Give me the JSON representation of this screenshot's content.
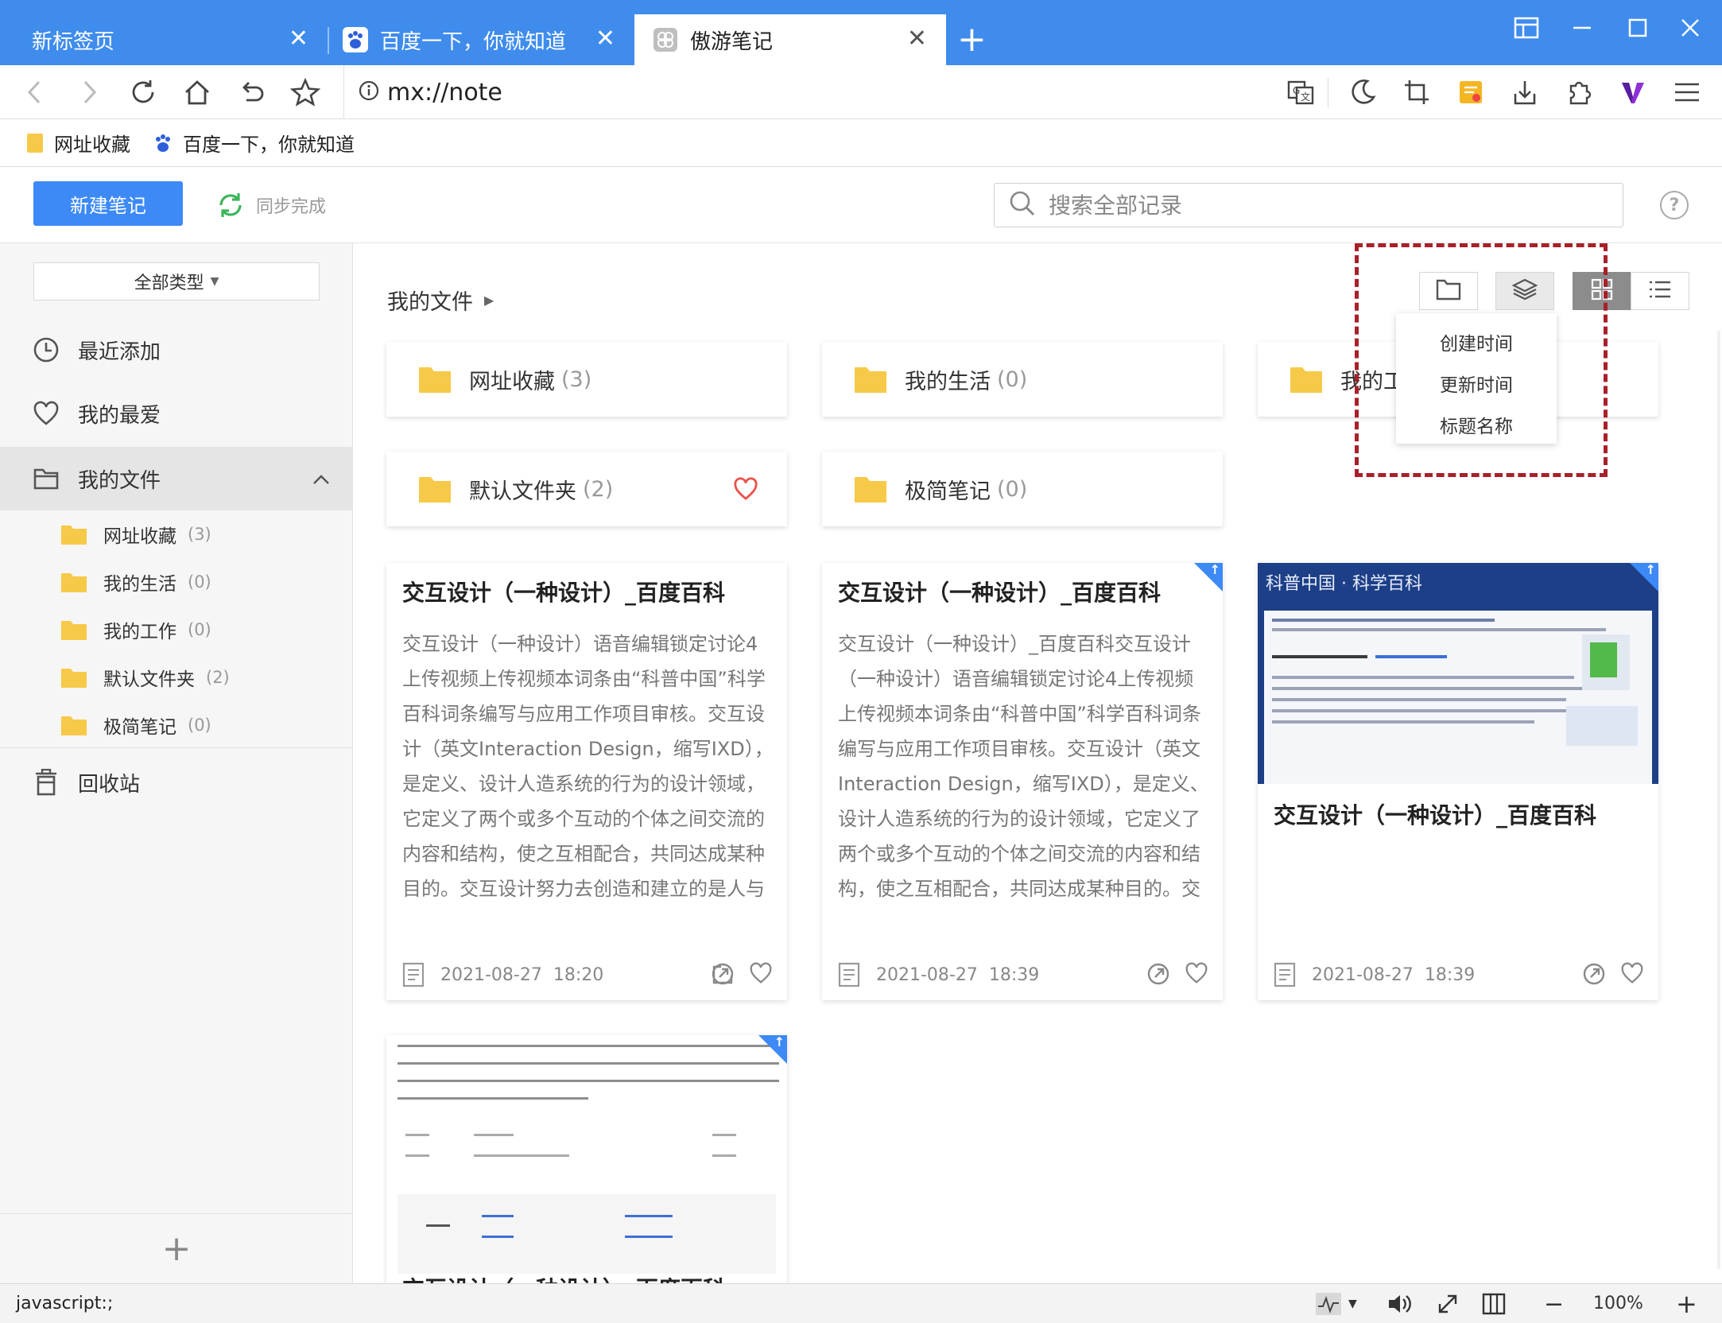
{
  "browser": {
    "tabs": [
      {
        "title": "新标签页",
        "active": false
      },
      {
        "title": "百度一下，你就知道",
        "active": false
      },
      {
        "title": "傲游笔记",
        "active": true
      }
    ],
    "address": "mx://note",
    "bookmarks": [
      {
        "label": "网址收藏",
        "icon": "folder-icon"
      },
      {
        "label": "百度一下，你就知道",
        "icon": "baidu-paw-icon"
      }
    ],
    "status_text": "javascript:;",
    "zoom": "100%"
  },
  "header": {
    "new_note_label": "新建笔记",
    "sync_label": "同步完成",
    "search_placeholder": "搜索全部记录",
    "help_label": "?"
  },
  "sidebar": {
    "type_filter": "全部类型",
    "items": {
      "recent": "最近添加",
      "favorites": "我的最爱",
      "my_files": "我的文件",
      "trash": "回收站"
    },
    "folders": [
      {
        "name": "网址收藏",
        "count": "(3)"
      },
      {
        "name": "我的生活",
        "count": "(0)"
      },
      {
        "name": "我的工作",
        "count": "(0)"
      },
      {
        "name": "默认文件夹",
        "count": "(2)"
      },
      {
        "name": "极简笔记",
        "count": "(0)"
      }
    ],
    "add_label": "+"
  },
  "main": {
    "breadcrumb": "我的文件",
    "folder_cards": [
      {
        "name": "网址收藏",
        "count": "(3)"
      },
      {
        "name": "我的生活",
        "count": "(0)"
      },
      {
        "name": "我的工",
        "count": ""
      },
      {
        "name": "默认文件夹",
        "count": "(2)"
      },
      {
        "name": "极简笔记",
        "count": "(0)"
      }
    ],
    "notes": [
      {
        "title": "交互设计（一种设计）_百度百科",
        "body": "交互设计（一种设计）语音编辑锁定讨论4上传视频上传视频本词条由“科普中国”科学百科词条编写与应用工作项目审核。交互设计（英文Interaction Design，缩写IXD），是定义、设计人造系统的行为的设计领域，它定义了两个或多个互动的个体之间交流的内容和结构，使之互相配合，共同达成某种目的。交互设计努力去创造和建立的是人与产品及服务之间有意义的关系，以“在充满社…",
        "date": "2021-08-27",
        "time": "18:20"
      },
      {
        "title": "交互设计（一种设计）_百度百科",
        "body": "交互设计（一种设计）_百度百科交互设计（一种设计）语音编辑锁定讨论4上传视频上传视频本词条由“科普中国”科学百科词条编写与应用工作项目审核。交互设计（英文Interaction Design，缩写IXD），是定义、设计人造系统的行为的设计领域，它定义了两个或多个互动的个体之间交流的内容和结构，使之互相配合，共同达成某种目的。交互设计努力去创造和建立的是人与产品及…",
        "date": "2021-08-27",
        "time": "18:39"
      },
      {
        "title": "交互设计（一种设计）_百度百科",
        "thumb_caption": "科普中国 · 科学百科",
        "date": "2021-08-27",
        "time": "18:39"
      },
      {
        "title": "交互设计（一种设计）_百度百科"
      }
    ]
  },
  "sort_menu": {
    "options": [
      "创建时间",
      "更新时间",
      "标题名称"
    ]
  },
  "colors": {
    "tabbar": "#3f8ced",
    "primary": "#3d8af7",
    "folder": "#f7c948",
    "heart_active": "#e8544c",
    "highlight": "#a8202a"
  }
}
